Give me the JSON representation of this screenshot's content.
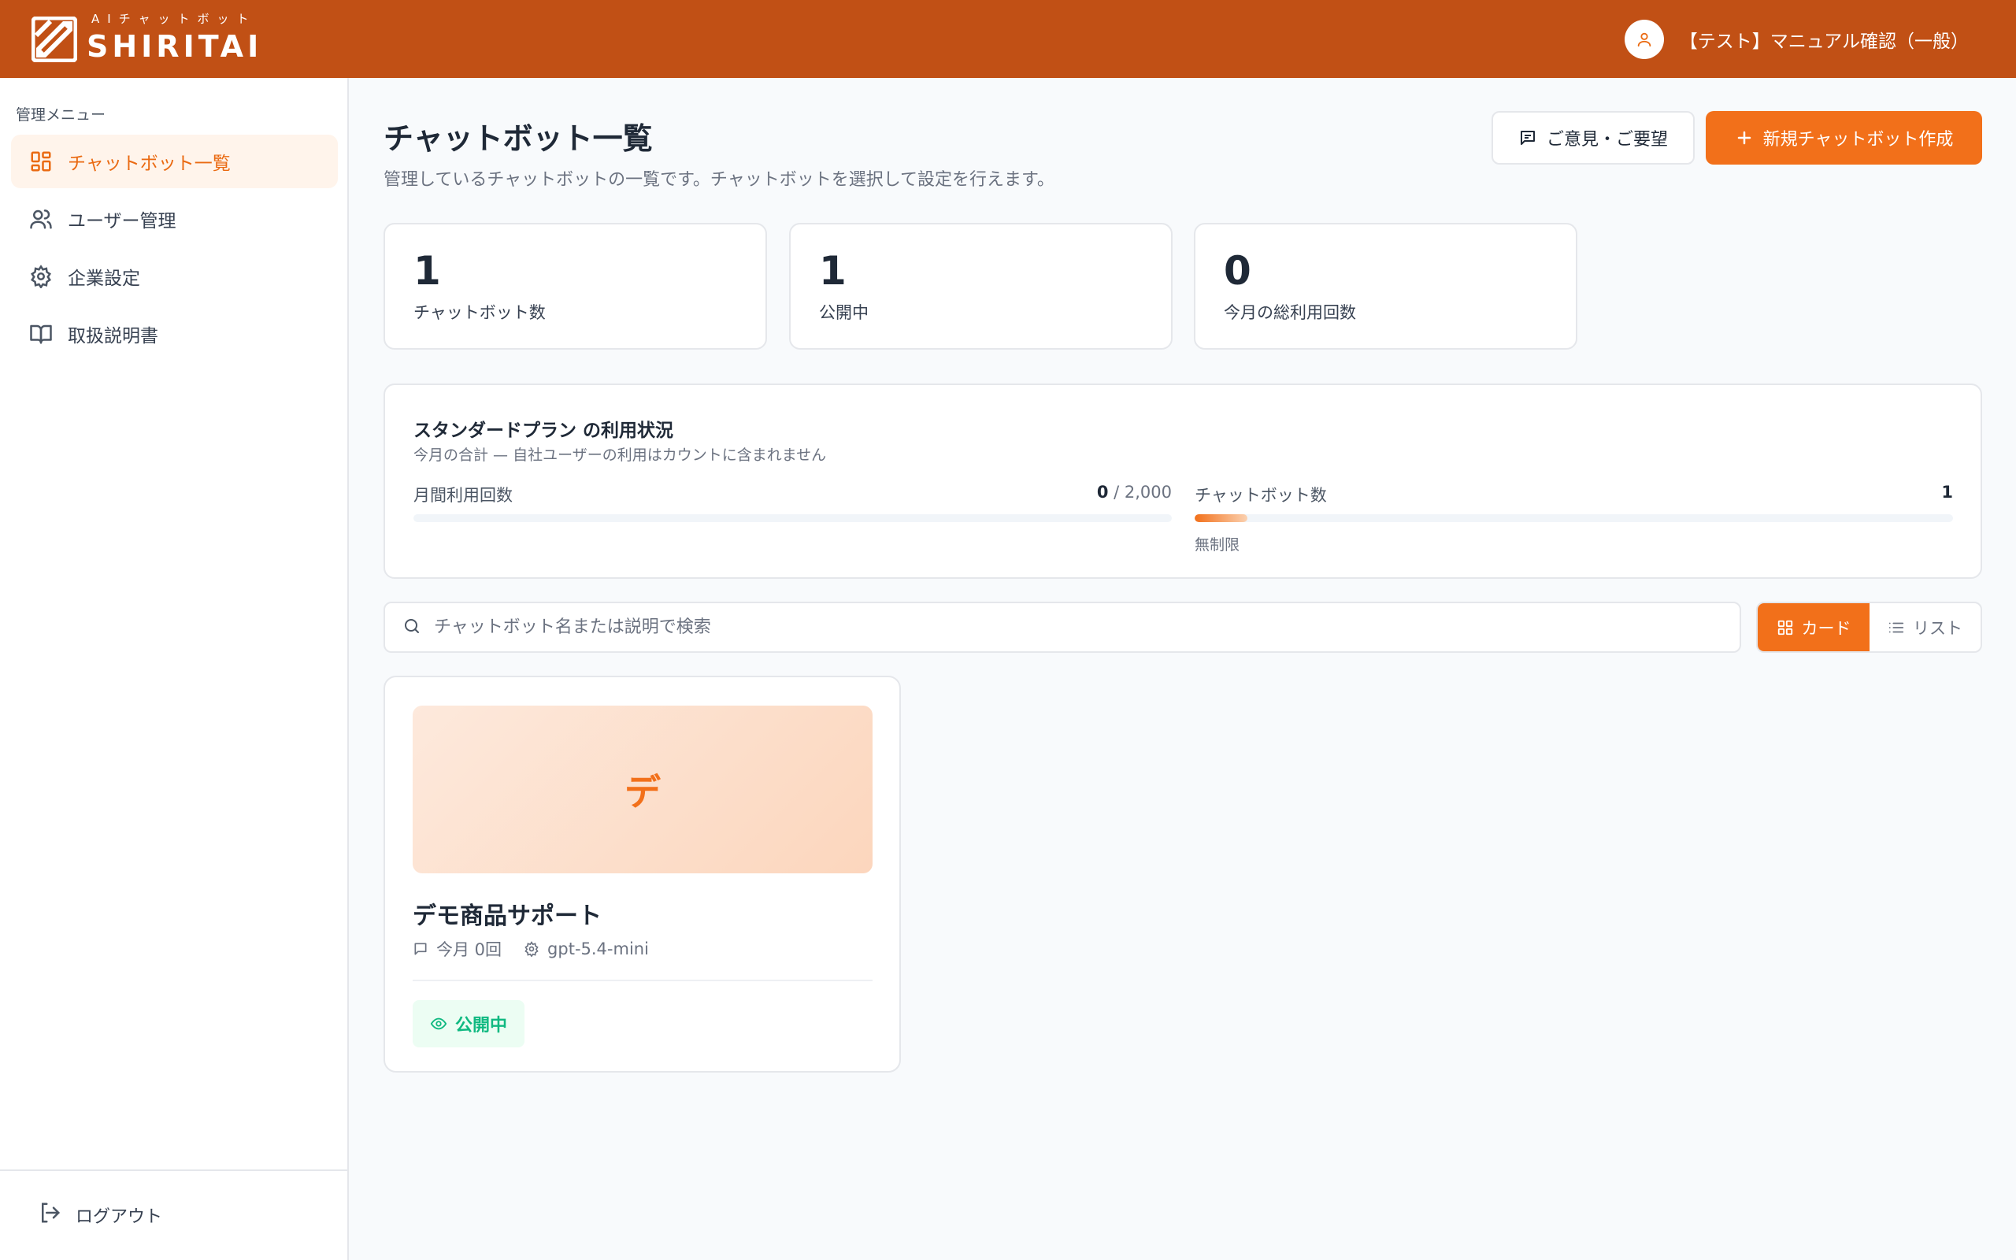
{
  "brand": {
    "logo_sub": "AIチャットボット",
    "logo_main": "SHIRITAI",
    "color": "#c15015",
    "accent": "#f2701a"
  },
  "header": {
    "user_name": "【テスト】マニュアル確認（一般）",
    "avatar_icon": "user-icon"
  },
  "sidebar": {
    "heading": "管理メニュー",
    "items": [
      {
        "label": "チャットボット一覧",
        "icon": "dashboard-grid-icon",
        "active": true
      },
      {
        "label": "ユーザー管理",
        "icon": "users-icon",
        "active": false
      },
      {
        "label": "企業設定",
        "icon": "gear-icon",
        "active": false
      },
      {
        "label": "取扱説明書",
        "icon": "book-icon",
        "active": false
      }
    ],
    "logout_label": "ログアウト"
  },
  "main": {
    "title": "チャットボット一覧",
    "description": "管理しているチャットボットの一覧です。チャットボットを選択して設定を行えます。",
    "feedback_button": "ご意見・ご要望",
    "new_button": "新規チャットボット作成"
  },
  "stats": [
    {
      "value": "1",
      "label": "チャットボット数"
    },
    {
      "value": "1",
      "label": "公開中"
    },
    {
      "value": "0",
      "label": "今月の総利用回数"
    }
  ],
  "usage": {
    "title": "スタンダードプラン の利用状況",
    "subtitle": "今月の合計 — 自社ユーザーの利用はカウントに含まれません",
    "monthly": {
      "label": "月間利用回数",
      "used": "0",
      "limit": "/ 2,000",
      "fill_fraction": 0
    },
    "chatbots": {
      "label": "チャットボット数",
      "value": "1",
      "note": "無制限",
      "fill_fraction": 0.07
    }
  },
  "search": {
    "placeholder": "チャットボット名または説明で検索"
  },
  "view_toggle": {
    "card_label": "カード",
    "list_label": "リスト",
    "selected": "card"
  },
  "chatbots": [
    {
      "initial": "デ",
      "name": "デモ商品サポート",
      "usage_text": "今月 0回",
      "model": "gpt-5.4-mini",
      "status": "公開中"
    }
  ]
}
